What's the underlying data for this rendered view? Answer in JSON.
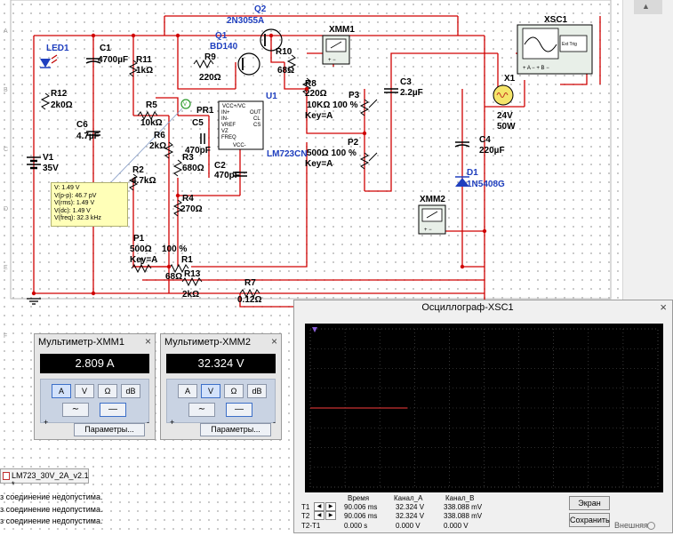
{
  "schematic": {
    "row_labels": [
      "A",
      "B",
      "C",
      "D",
      "E",
      "F"
    ],
    "components": {
      "led1": "LED1",
      "c1": "C1",
      "c1_val": "4700µF",
      "r11": "R11",
      "r11_val": "1kΩ",
      "r12": "R12",
      "r12_val": "2k0Ω",
      "c6": "C6",
      "c6_val": "4.7µF",
      "v1": "V1",
      "v1_val": "35V",
      "q2": "Q2",
      "q2_model": "2N3055A",
      "q1": "Q1",
      "q1_model": "BD140",
      "r9": "R9",
      "r9_val": "220Ω",
      "r10": "R10",
      "r10_val": "68Ω",
      "u1": "U1",
      "u1_model": "LM723CN",
      "pr1": "PR1",
      "r5": "R5",
      "r5_val": "10kΩ",
      "r6": "R6",
      "r6_val": "2kΩ",
      "c5": "C5",
      "c5_val": "470pF",
      "r3": "R3",
      "r3_val": "680Ω",
      "c2": "C2",
      "c2_val": "470pF",
      "r4": "R4",
      "r4_val": "270Ω",
      "r2": "R2",
      "r2_val": "4.7kΩ",
      "r8": "R8",
      "r8_val": "220Ω",
      "p3": "P3",
      "p3_val": "10KΩ 100 %",
      "p3_key": "Key=A",
      "p2": "P2",
      "p2_val": "500Ω 100 %",
      "p2_key": "Key=A",
      "c3": "C3",
      "c3_val": "2.2µF",
      "xmm1": "XMM1",
      "xmm2": "XMM2",
      "xsc1": "XSC1",
      "x1": "X1",
      "x1_v": "24V",
      "x1_w": "50W",
      "c4": "C4",
      "c4_val": "220µF",
      "d1": "D1",
      "d1_model": "1N5408G",
      "p1": "P1",
      "p1_val": "500Ω",
      "p1_pct": "100 %",
      "p1_key": "Key=A",
      "r1": "R1",
      "r1_val": "68Ω",
      "r13": "R13",
      "r13_val": "2kΩ",
      "r7": "R7",
      "r7_val": "0.12Ω",
      "u1_pins": [
        "VCC+/VC",
        "IN+",
        "IN-",
        "VREF",
        "VZ",
        "FREQ",
        "VCC-",
        "OUT",
        "CL",
        "CS"
      ],
      "ext_trig": "Ext Trig"
    },
    "probe": {
      "v": "V: 1.49 V",
      "vpp": "V(p-p): 46.7 pV",
      "vrms": "V(rms): 1.49 V",
      "vdc": "V(dc): 1.49 V",
      "freq": "V(freq): 32.3 kHz"
    }
  },
  "multimeter1": {
    "title": "Мультиметр-XMM1",
    "reading": "2.809 A",
    "modes": [
      "A",
      "V",
      "Ω",
      "dB"
    ],
    "active_mode": "A",
    "params_label": "Параметры...",
    "plus": "+",
    "minus": "-"
  },
  "multimeter2": {
    "title": "Мультиметр-XMM2",
    "reading": "32.324 V",
    "modes": [
      "A",
      "V",
      "Ω",
      "dB"
    ],
    "active_mode": "V",
    "params_label": "Параметры...",
    "plus": "+",
    "minus": "-"
  },
  "tab": {
    "label": "LM723_30V_2A_v2.1 *"
  },
  "log": [
    "з соединение недопустима.",
    "з соединение недопустима.",
    "з соединение недопустима."
  ],
  "oscilloscope": {
    "title": "Осциллограф-XSC1",
    "headers": {
      "time": "Время",
      "chA": "Канал_A",
      "chB": "Канал_B"
    },
    "rows": [
      {
        "label": "T1",
        "time": "90.006 ms",
        "chA": "32.324 V",
        "chB": "338.088 mV"
      },
      {
        "label": "T2",
        "time": "90.006 ms",
        "chA": "32.324 V",
        "chB": "338.088 mV"
      },
      {
        "label": "T2-T1",
        "time": "0.000 s",
        "chA": "0.000 V",
        "chB": "0.000 V"
      }
    ],
    "screen_button": "Экран",
    "save_button": "Сохранить",
    "external_label": "Внешняя",
    "trace_color": "#c83232",
    "trace_fraction": 0.28
  },
  "colors": {
    "wire": "#d00000",
    "blue_label": "#1f3fbf",
    "ground_wire": "#d00000"
  },
  "chart_data": {
    "type": "line",
    "series": [
      {
        "name": "Канал_A",
        "values": [
          0,
          0
        ]
      }
    ]
  }
}
